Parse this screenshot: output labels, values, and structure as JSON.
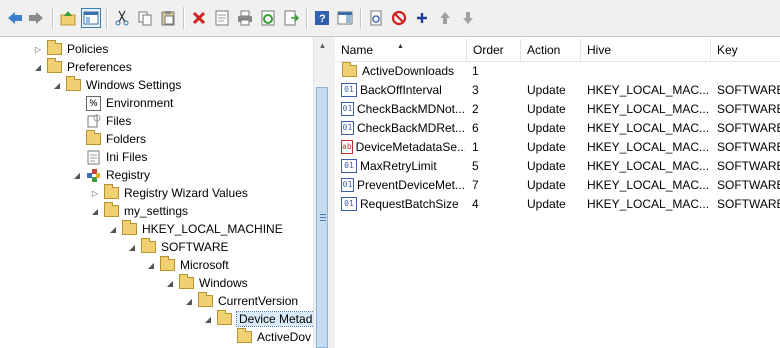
{
  "toolbar": {
    "buttons": [
      "back",
      "forward",
      "up-level",
      "show-hide-tree",
      "cut",
      "copy",
      "paste",
      "delete",
      "properties",
      "print",
      "refresh",
      "export-list",
      "help",
      "show-hide-action-pane",
      "new-item",
      "disable-item",
      "add-item",
      "move-up",
      "move-down"
    ]
  },
  "tree": {
    "items": [
      {
        "label": "Policies",
        "expanded": false,
        "icon": "folder-icon"
      },
      {
        "label": "Preferences",
        "expanded": true,
        "icon": "folder-icon"
      },
      {
        "label": "Windows Settings",
        "expanded": true,
        "icon": "folder-icon"
      },
      {
        "label": "Environment",
        "icon": "environment-icon"
      },
      {
        "label": "Files",
        "icon": "files-icon"
      },
      {
        "label": "Folders",
        "icon": "folder-icon"
      },
      {
        "label": "Ini Files",
        "icon": "ini-files-icon"
      },
      {
        "label": "Registry",
        "expanded": true,
        "icon": "registry-icon"
      },
      {
        "label": "Registry Wizard Values",
        "expanded": false,
        "icon": "folder-icon"
      },
      {
        "label": "my_settings",
        "expanded": true,
        "icon": "folder-icon"
      },
      {
        "label": "HKEY_LOCAL_MACHINE",
        "expanded": true,
        "icon": "folder-icon"
      },
      {
        "label": "SOFTWARE",
        "expanded": true,
        "icon": "folder-icon"
      },
      {
        "label": "Microsoft",
        "expanded": true,
        "icon": "folder-icon"
      },
      {
        "label": "Windows",
        "expanded": true,
        "icon": "folder-icon"
      },
      {
        "label": "CurrentVersion",
        "expanded": true,
        "icon": "folder-icon"
      },
      {
        "label": "Device Metad",
        "expanded": true,
        "selected": true,
        "icon": "folder-open-icon"
      },
      {
        "label": "ActiveDov",
        "icon": "folder-icon"
      }
    ]
  },
  "list": {
    "columns": [
      "Name",
      "Order",
      "Action",
      "Hive",
      "Key"
    ],
    "rows": [
      {
        "name": "ActiveDownloads",
        "order": "1",
        "action": "",
        "hive": "",
        "key": "",
        "icon": "folder-icon"
      },
      {
        "name": "BackOffInterval",
        "order": "3",
        "action": "Update",
        "hive": "HKEY_LOCAL_MAC...",
        "key": "SOFTWARE\\",
        "icon": "registry-dword-icon"
      },
      {
        "name": "CheckBackMDNot...",
        "order": "2",
        "action": "Update",
        "hive": "HKEY_LOCAL_MAC...",
        "key": "SOFTWARE\\",
        "icon": "registry-dword-icon"
      },
      {
        "name": "CheckBackMDRet...",
        "order": "6",
        "action": "Update",
        "hive": "HKEY_LOCAL_MAC...",
        "key": "SOFTWARE\\",
        "icon": "registry-dword-icon"
      },
      {
        "name": "DeviceMetadataSe...",
        "order": "1",
        "action": "Update",
        "hive": "HKEY_LOCAL_MAC...",
        "key": "SOFTWARE\\",
        "icon": "registry-string-icon"
      },
      {
        "name": "MaxRetryLimit",
        "order": "5",
        "action": "Update",
        "hive": "HKEY_LOCAL_MAC...",
        "key": "SOFTWARE\\",
        "icon": "registry-dword-icon"
      },
      {
        "name": "PreventDeviceMet...",
        "order": "7",
        "action": "Update",
        "hive": "HKEY_LOCAL_MAC...",
        "key": "SOFTWARE\\",
        "icon": "registry-dword-icon"
      },
      {
        "name": "RequestBatchSize",
        "order": "4",
        "action": "Update",
        "hive": "HKEY_LOCAL_MAC...",
        "key": "SOFTWARE\\",
        "icon": "registry-dword-icon"
      }
    ]
  },
  "colors": {
    "accent": "#3c7fb1",
    "selection": "#d9ebf9",
    "folder": "#f0d070"
  }
}
